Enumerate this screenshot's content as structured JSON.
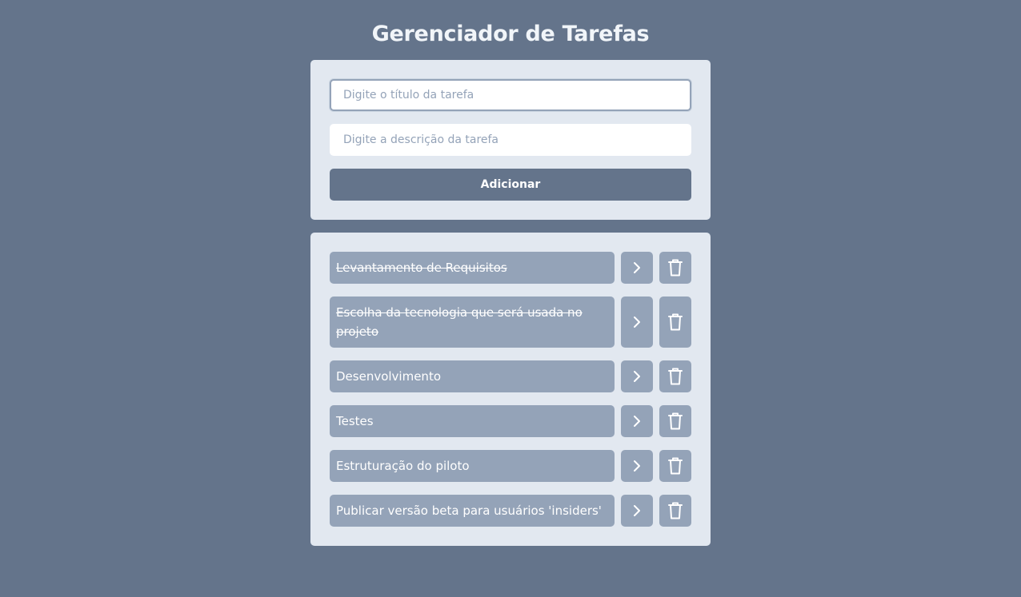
{
  "app": {
    "title": "Gerenciador de Tarefas"
  },
  "form": {
    "title_value": "",
    "title_placeholder": "Digite o título da tarefa",
    "description_value": "",
    "description_placeholder": "Digite a descrição da tarefa",
    "add_label": "Adicionar"
  },
  "tasks": [
    {
      "title": "Levantamento de Requisitos",
      "completed": true
    },
    {
      "title": "Escolha da tecnologia que será usada no projeto",
      "completed": true
    },
    {
      "title": "Desenvolvimento",
      "completed": false
    },
    {
      "title": "Testes",
      "completed": false
    },
    {
      "title": "Estruturação do piloto",
      "completed": false
    },
    {
      "title": "Publicar versão beta para usuários 'insiders'",
      "completed": false
    }
  ],
  "icons": {
    "details": "chevron-right-icon",
    "delete": "trash-icon"
  },
  "colors": {
    "background": "#64748b",
    "panel": "#e2e8f0",
    "item": "#94a3b8",
    "button": "#64748b",
    "text_light": "#ffffff"
  }
}
